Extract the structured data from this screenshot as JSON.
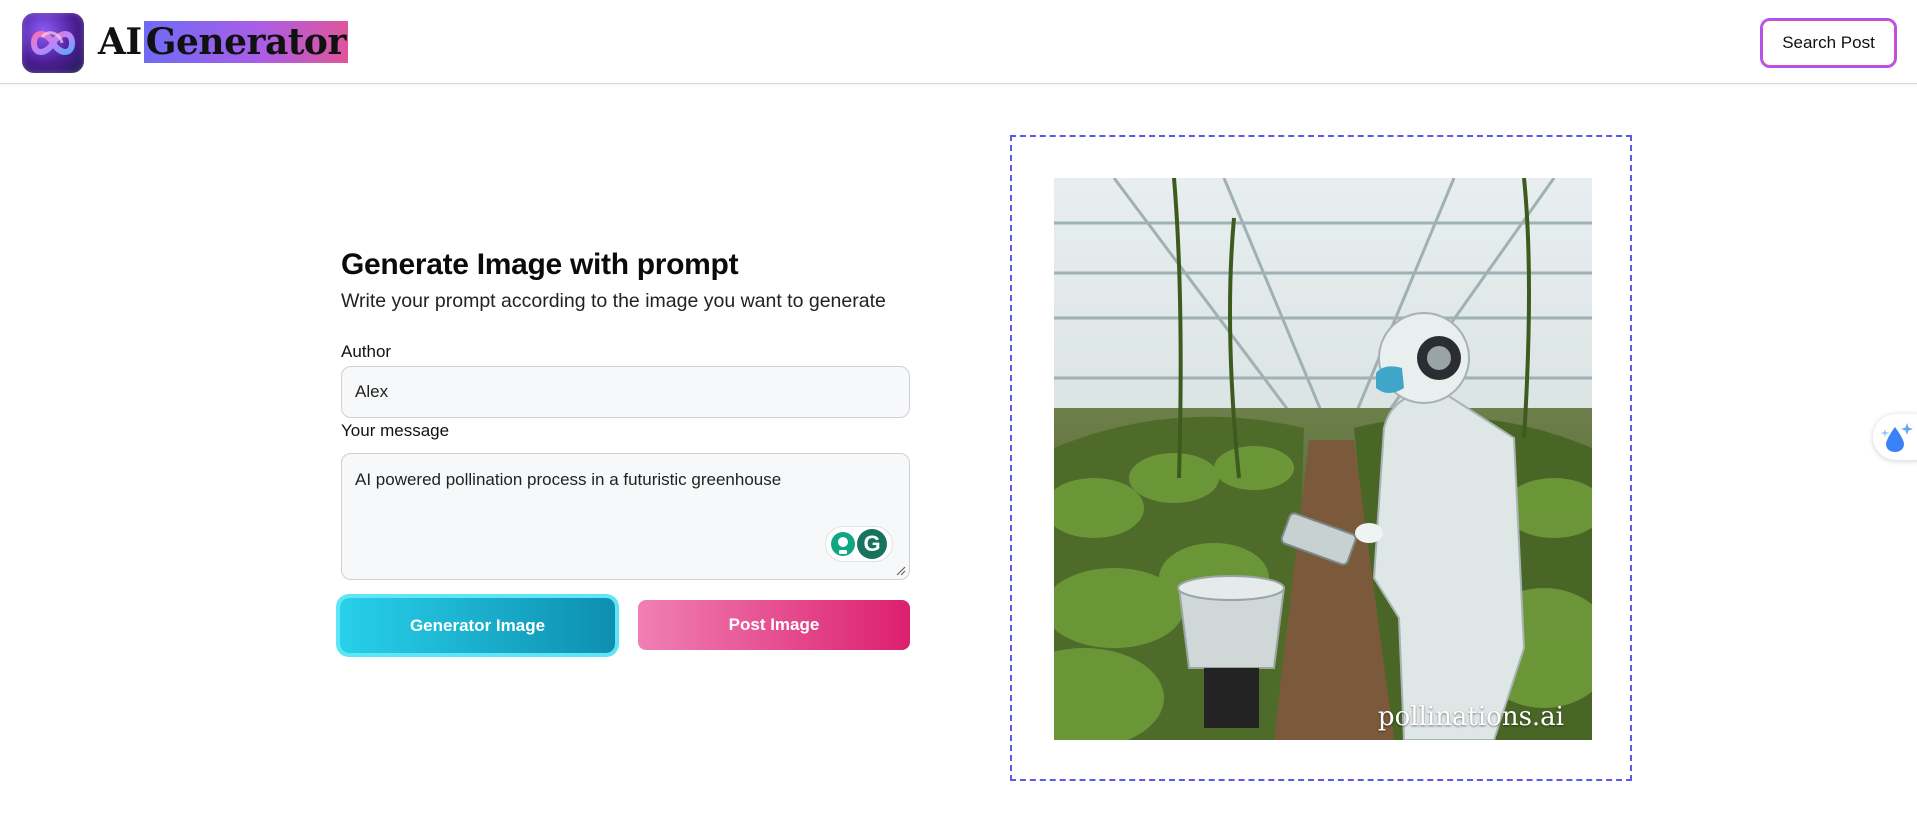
{
  "header": {
    "brand_ai": "AI",
    "brand_generator": "Generator",
    "search_post_label": "Search Post"
  },
  "form": {
    "title": "Generate Image with prompt",
    "subtitle": "Write your prompt according to the image you want to generate",
    "author_label": "Author",
    "author_value": "Alex",
    "message_label": "Your message",
    "message_value": "AI powered pollination process in a futuristic greenhouse",
    "generate_button_label": "Generator Image",
    "post_button_label": "Post Image"
  },
  "preview": {
    "watermark": "pollinations.ai"
  },
  "colors": {
    "accent_cyan": "#27d0ea",
    "accent_pink": "#dc1f6f",
    "frame_border": "#5b5be8",
    "brand_gradient_start": "#6f6bf5",
    "brand_gradient_end": "#e0559b"
  },
  "icons": {
    "logo": "infinity-loop-logo-icon",
    "grammarly_suggest": "lightbulb-icon",
    "grammarly": "grammarly-g-icon",
    "side_widget": "water-drop-sparkle-icon"
  }
}
